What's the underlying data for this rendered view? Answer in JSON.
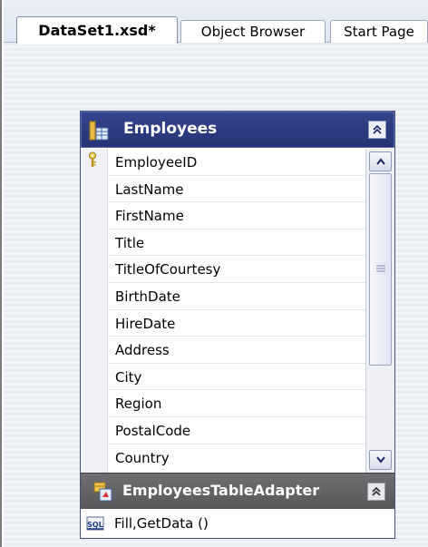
{
  "tabs": [
    {
      "label": "DataSet1.xsd*",
      "active": true
    },
    {
      "label": "Object Browser",
      "active": false
    },
    {
      "label": "Start Page",
      "active": false
    }
  ],
  "table": {
    "title": "Employees",
    "collapse_glyph": "⌃",
    "key_column": "EmployeeID",
    "columns": [
      "EmployeeID",
      "LastName",
      "FirstName",
      "Title",
      "TitleOfCourtesy",
      "BirthDate",
      "HireDate",
      "Address",
      "City",
      "Region",
      "PostalCode",
      "Country"
    ]
  },
  "adapter": {
    "title": "EmployeesTableAdapter",
    "methods": "Fill,GetData ()"
  },
  "colors": {
    "table_header": "#2b3a80",
    "adapter_header": "#626265"
  },
  "icons": {
    "table": "datatable-icon",
    "key": "primary-key-icon",
    "adapter": "table-adapter-icon",
    "sql": "sql-query-icon"
  }
}
